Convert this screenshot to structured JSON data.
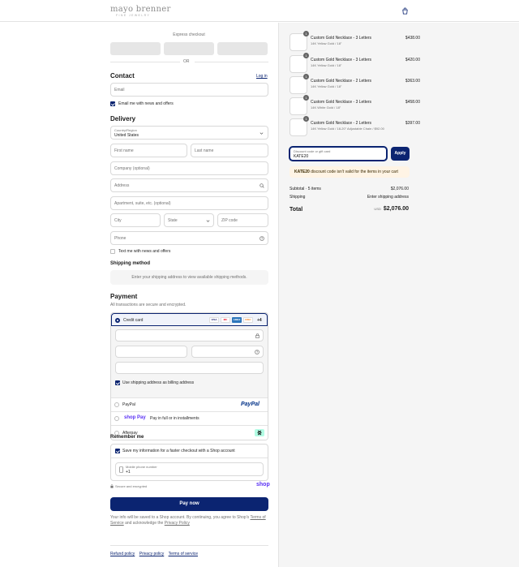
{
  "brand": {
    "logo": "mayo brenner",
    "logo_sub": "FINE JEWELRY"
  },
  "icons": {
    "cart": "shopping-bag-icon",
    "search": "search-icon",
    "lock": "lock-icon",
    "help": "question-circle-icon",
    "phone": "mobile-phone-icon"
  },
  "colors": {
    "primary": "#0b2471",
    "warning_bg": "#fff4e5"
  },
  "express": {
    "label": "Express checkout",
    "or": "OR"
  },
  "contact": {
    "title": "Contact",
    "login": "Log in",
    "email_placeholder": "Email",
    "news_label": "Email me with news and offers"
  },
  "delivery": {
    "title": "Delivery",
    "country_label": "Country/Region",
    "country_value": "United States",
    "first_name": "First name",
    "last_name": "Last name",
    "company": "Company (optional)",
    "address": "Address",
    "apartment": "Apartment, suite, etc. (optional)",
    "city": "City",
    "state": "State",
    "zip": "ZIP code",
    "phone": "Phone",
    "text_news": "Text me with news and offers"
  },
  "shipping": {
    "title": "Shipping method",
    "notice": "Enter your shipping address to view available shipping methods."
  },
  "payment": {
    "title": "Payment",
    "subtitle": "All transactions are secure and encrypted.",
    "credit_card": "Credit card",
    "more_cards": "+4",
    "card_brands": [
      "VISA",
      "MC",
      "AMEX",
      "DISC"
    ],
    "billing_same": "Use shipping address as billing address",
    "paypal": "PayPal",
    "shoppay_text": "Pay in full or in installments",
    "shoppay_logo": "shop Pay",
    "afterpay": "Afterpay"
  },
  "remember": {
    "title": "Remember me",
    "save_info": "Save my information for a faster checkout with a Shop account",
    "mobile_label": "Mobile phone number",
    "mobile_value": "+1",
    "secure": "Secure and encrypted",
    "shop_logo": "shop"
  },
  "pay_now": "Pay now",
  "disclaimer": {
    "line1": "Your info will be saved to a Shop account. By continuing, you agree to Shop's",
    "terms": "Terms of Service",
    "middle": "and acknowledge the",
    "privacy": "Privacy Policy"
  },
  "footer": {
    "refund": "Refund policy",
    "privacy": "Privacy policy",
    "terms": "Terms of service"
  },
  "cart": {
    "items": [
      {
        "qty": "1",
        "name": "Custom Gold Necklace - 3 Letters",
        "variant": "14K Yellow Gold / 18\"",
        "price": "$438.00"
      },
      {
        "qty": "1",
        "name": "Custom Gold Necklace - 3 Letters",
        "variant": "14K Yellow Gold / 18\"",
        "price": "$420.00"
      },
      {
        "qty": "1",
        "name": "Custom Gold Necklace - 2 Letters",
        "variant": "14K Yellow Gold / 18\"",
        "price": "$363.00"
      },
      {
        "qty": "1",
        "name": "Custom Gold Necklace - 3 Letters",
        "variant": "14K White Gold / 18\"",
        "price": "$458.00"
      },
      {
        "qty": "1",
        "name": "Custom Gold Necklace - 2 Letters",
        "variant": "14K Yellow Gold / 18-20\" Adjustable Chain / $92.00",
        "price": "$397.00"
      }
    ],
    "discount_label": "Discount code or gift card",
    "discount_value": "KATE20",
    "apply": "Apply",
    "error_code": "KATE20",
    "error_text": "discount code isn't valid for the items in your cart",
    "subtotal_label": "Subtotal · 5 items",
    "subtotal_value": "$2,076.00",
    "shipping_label": "Shipping",
    "shipping_value": "Enter shipping address",
    "total_label": "Total",
    "currency": "USD",
    "total_value": "$2,076.00"
  }
}
